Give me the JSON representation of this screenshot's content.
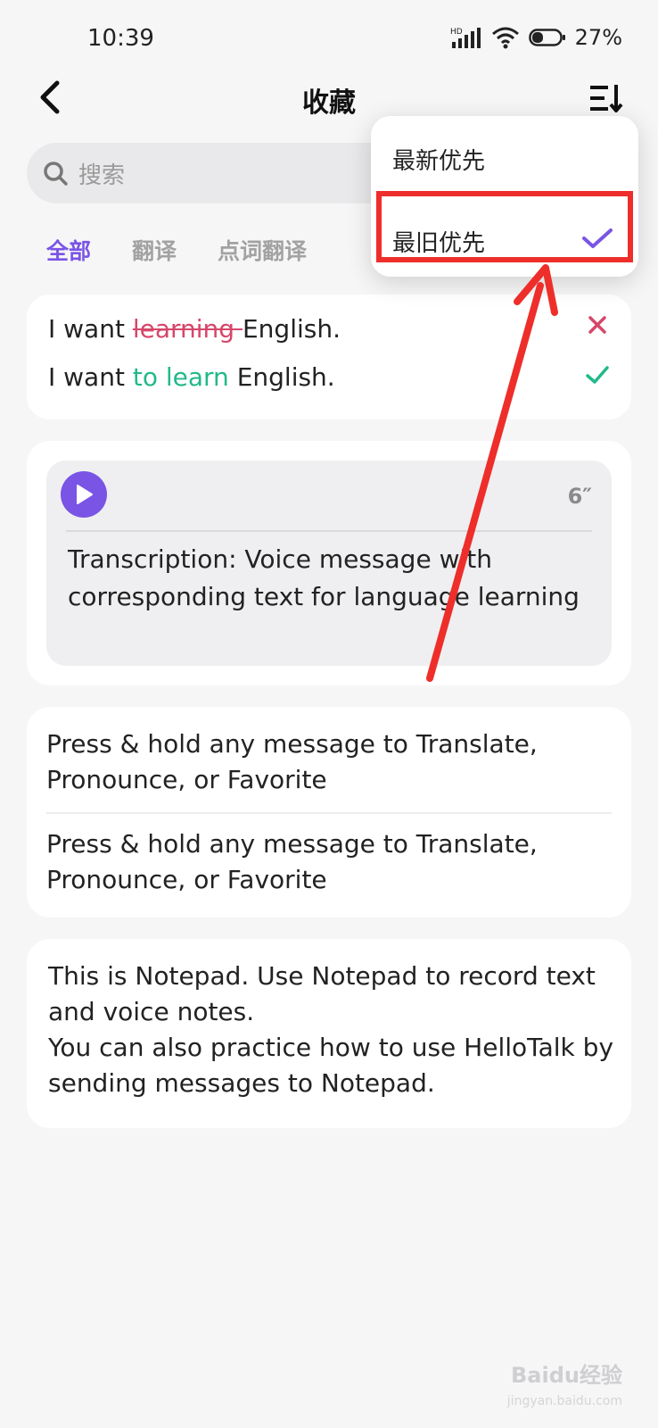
{
  "status_bar": {
    "time": "10:39",
    "hd_label": "HD",
    "battery_percent": "27%",
    "icons": [
      "signal-icon",
      "wifi-icon",
      "battery-icon"
    ]
  },
  "header": {
    "title": "收藏",
    "back_icon": "back-arrow-icon",
    "sort_icon": "sort-icon"
  },
  "search": {
    "placeholder": "搜索"
  },
  "tabs": [
    {
      "label": "全部",
      "active": true
    },
    {
      "label": "翻译",
      "active": false
    },
    {
      "label": "点词翻译",
      "active": false
    }
  ],
  "cards": {
    "correction": {
      "wrong_prefix": "I want ",
      "wrong_struck": "learning ",
      "wrong_suffix": "English.",
      "right_prefix": "I want ",
      "right_highlight": "to learn",
      "right_suffix": " English."
    },
    "voice": {
      "duration": "6″",
      "transcription": "Transcription: Voice message with corresponding text for language learning"
    },
    "tips": [
      "Press & hold any message to Translate, Pronounce, or Favorite",
      "Press & hold any message to Translate, Pronounce, or Favorite"
    ],
    "note": {
      "line1": "This is Notepad. Use Notepad to record text and voice notes.",
      "line2": "You can also practice how to use HelloTalk by sending messages to Notepad."
    }
  },
  "sort_menu": {
    "options": [
      {
        "label": "最新优先",
        "selected": false
      },
      {
        "label": "最旧优先",
        "selected": true
      }
    ]
  },
  "watermark": {
    "brand": "Baidu经验",
    "url": "jingyan.baidu.com"
  },
  "colors": {
    "accent": "#7a54e5",
    "wrong": "#d6476a",
    "correct": "#22b98a",
    "annotation": "#ee2e2a"
  }
}
